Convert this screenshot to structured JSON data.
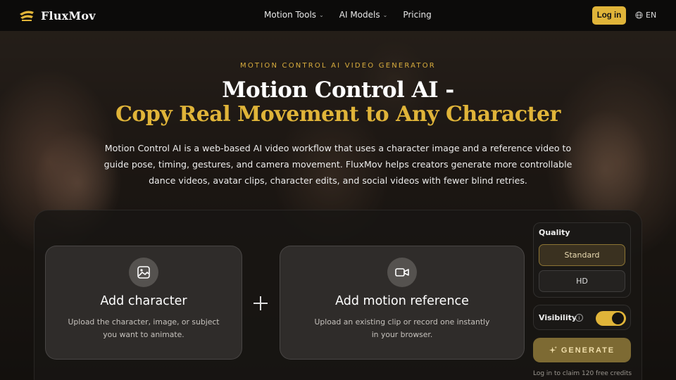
{
  "header": {
    "brand": "FluxMov",
    "nav": [
      {
        "label": "Motion Tools",
        "has_dropdown": true
      },
      {
        "label": "AI Models",
        "has_dropdown": true
      },
      {
        "label": "Pricing",
        "has_dropdown": false
      }
    ],
    "login_label": "Log in",
    "language": "EN"
  },
  "hero": {
    "eyebrow": "MOTION CONTROL AI VIDEO GENERATOR",
    "title_line1": "Motion Control AI -",
    "title_line2": "Copy Real Movement to Any Character",
    "description": "Motion Control AI is a web-based AI video workflow that uses a character image and a reference video to guide pose, timing, gestures, and camera movement. FluxMov helps creators generate more controllable dance videos, avatar clips, character edits, and social videos with fewer blind retries."
  },
  "uploader": {
    "character": {
      "icon": "image-icon",
      "title": "Add character",
      "subtitle": "Upload the character, image, or subject you want to animate."
    },
    "motion": {
      "icon": "video-camera-icon",
      "title": "Add motion reference",
      "subtitle": "Upload an existing clip or record one instantly in your browser."
    }
  },
  "controls": {
    "quality_label": "Quality",
    "quality_options": [
      "Standard",
      "HD"
    ],
    "quality_selected": "Standard",
    "visibility_label": "Visibility",
    "visibility_on": true,
    "generate_label": "GENERATE",
    "claim_text": "Log in to claim 120 free credits"
  },
  "colors": {
    "accent": "#e0b439",
    "header_bg": "#0c0b0a",
    "card_bg": "#322f2c"
  }
}
